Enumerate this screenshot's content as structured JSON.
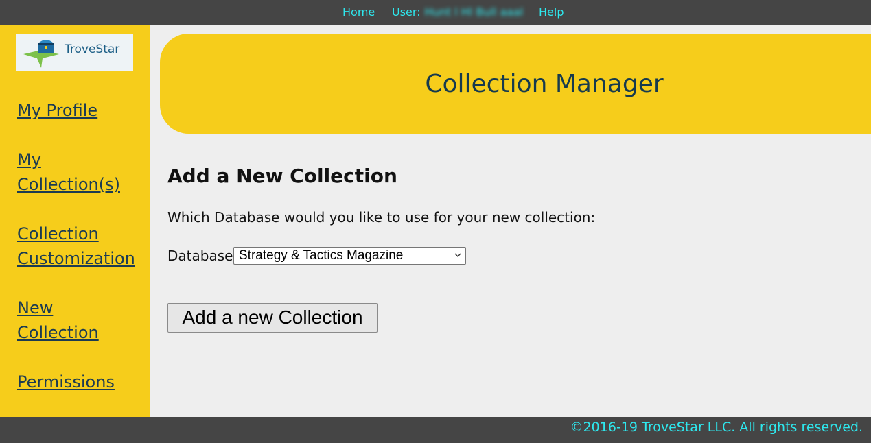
{
  "topnav": {
    "home": "Home",
    "user_label": "User:",
    "user_name": "Hunt l Hl Bull aaal",
    "help": "Help"
  },
  "logo": {
    "text": "TroveStar"
  },
  "sidebar": {
    "items": [
      {
        "label": "My Profile"
      },
      {
        "label": "My Collection(s)"
      },
      {
        "label": "Collection Customization"
      },
      {
        "label": "New Collection"
      },
      {
        "label": "Permissions"
      }
    ]
  },
  "banner": {
    "title": "Collection Manager"
  },
  "form": {
    "heading": "Add a New Collection",
    "question": "Which Database would you like to use for your new collection:",
    "database_label": "Database:",
    "database_selected": "Strategy & Tactics Magazine",
    "submit_label": "Add a new Collection"
  },
  "footer": {
    "copyright": "©2016-19 TroveStar LLC. All rights reserved."
  },
  "colors": {
    "accent_yellow": "#f6cd1b",
    "bar_dark": "#454545",
    "link_cyan": "#2ee8ee",
    "heading_navy": "#163a4e"
  }
}
